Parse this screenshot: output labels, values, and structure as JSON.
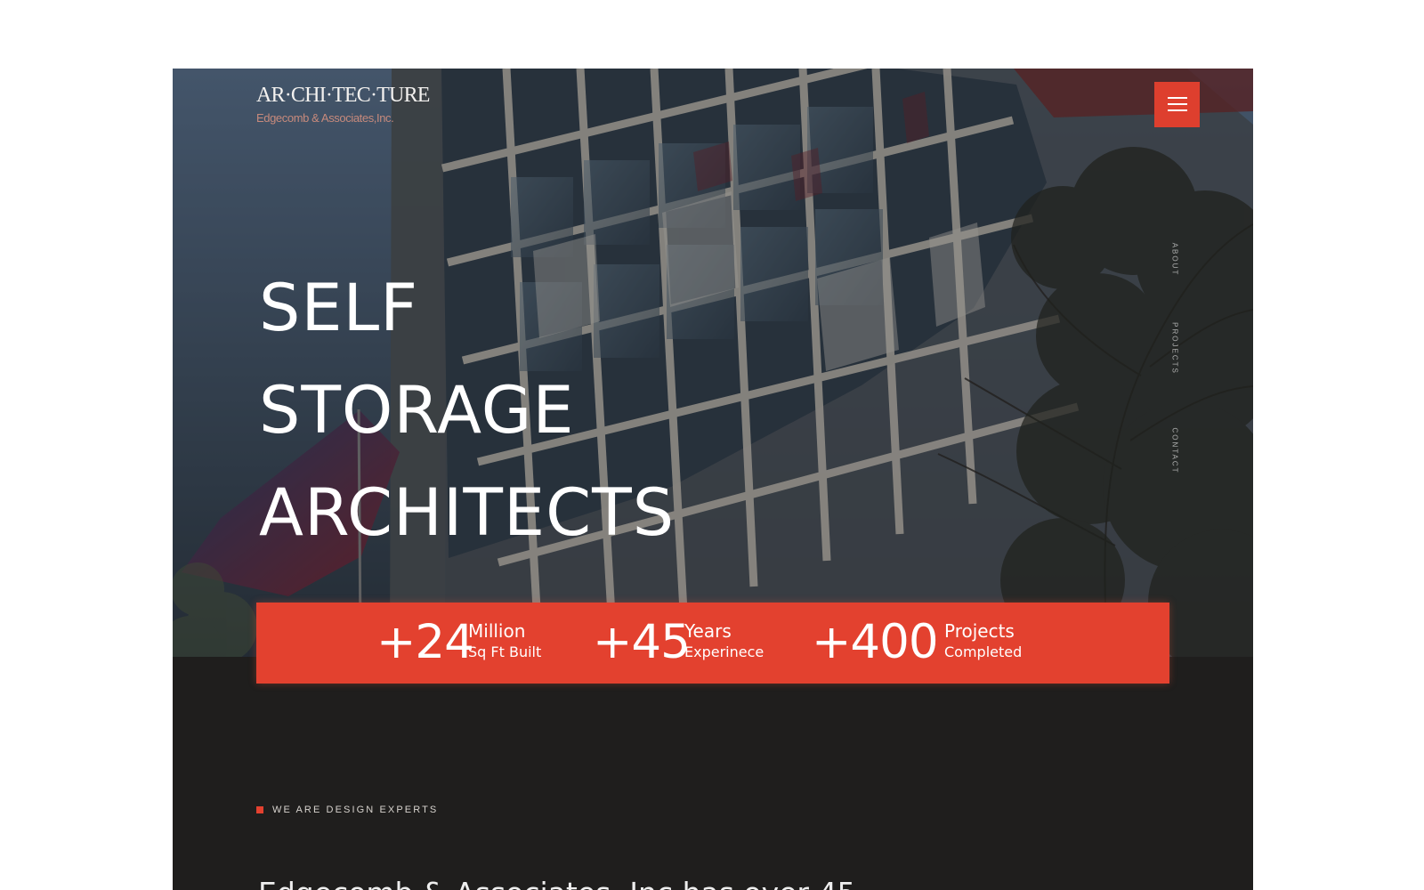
{
  "brand": {
    "logo_main": "AR·CHI·TEC·TURE",
    "logo_sub": "Edgecomb & Associates,Inc."
  },
  "navigation": {
    "menu_icon": "hamburger-menu-icon",
    "side_items": [
      "ABOUT",
      "PROJECTS",
      "CONTACT"
    ]
  },
  "hero": {
    "title_lines": [
      "SELF",
      "STORAGE",
      "ARCHITECTS"
    ]
  },
  "stats": [
    {
      "number": "+24",
      "label_top": "Million",
      "label_bottom": "Sq Ft Built"
    },
    {
      "number": "+45",
      "label_top": "Years",
      "label_bottom": "Experinece"
    },
    {
      "number": "+400",
      "label_top": "Projects",
      "label_bottom": "Completed"
    }
  ],
  "intro": {
    "eyebrow": "WE ARE DESIGN EXPERTS",
    "text": "Edgecomb & Associates, Inc has over 45"
  },
  "colors": {
    "accent": "#e3412f",
    "dark_background": "#1f1e1d",
    "white_background": "#ffffff"
  }
}
